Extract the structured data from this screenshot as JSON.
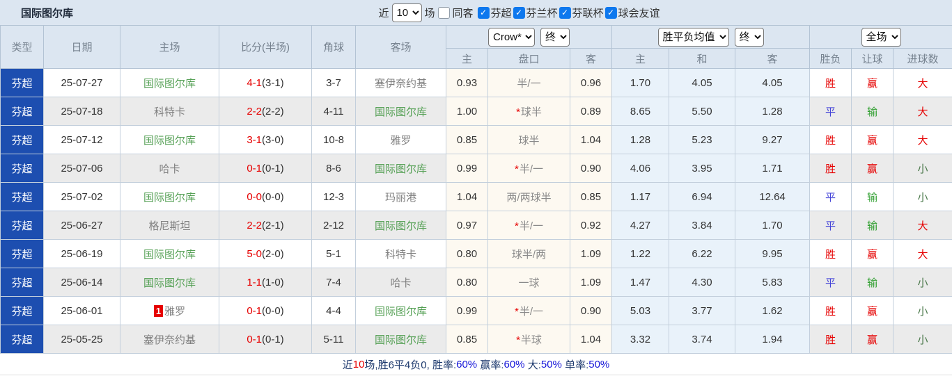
{
  "header": {
    "title": "国际图尔库",
    "recent_label": "近",
    "recent_value": "10",
    "matches_label": "场",
    "same_venue": {
      "label": "同客",
      "checked": false
    },
    "filters": [
      {
        "label": "芬超",
        "checked": true
      },
      {
        "label": "芬兰杯",
        "checked": true
      },
      {
        "label": "芬联杯",
        "checked": true
      },
      {
        "label": "球会友谊",
        "checked": true
      }
    ]
  },
  "table": {
    "headers": {
      "type": "类型",
      "date": "日期",
      "home": "主场",
      "score": "比分(半场)",
      "corner": "角球",
      "away": "客场",
      "odds_home": "主",
      "odds_line": "盘口",
      "odds_away": "客",
      "avg_home": "主",
      "avg_draw": "和",
      "avg_away": "客",
      "result": "胜负",
      "handicap": "让球",
      "goals": "进球数"
    },
    "selects": {
      "bookmaker": "Crow*",
      "bookmaker_stage": "终",
      "average": "胜平负均值",
      "average_stage": "终",
      "scope": "全场"
    },
    "rows": [
      {
        "league": "芬超",
        "date": "25-07-27",
        "home": {
          "name": "国际图尔库",
          "focus": true
        },
        "score": "4-1",
        "half": "(3-1)",
        "corner": "3-7",
        "away": {
          "name": "塞伊奈约基",
          "focus": false
        },
        "odds": [
          "0.93",
          "半/一",
          "0.96"
        ],
        "line_star": false,
        "avg": [
          "1.70",
          "4.05",
          "4.05"
        ],
        "result": {
          "text": "胜",
          "color": "red"
        },
        "handicap": {
          "text": "赢",
          "color": "red"
        },
        "goals": {
          "text": "大",
          "color": "red"
        }
      },
      {
        "league": "芬超",
        "date": "25-07-18",
        "home": {
          "name": "科特卡",
          "focus": false
        },
        "score": "2-2",
        "half": "(2-2)",
        "corner": "4-11",
        "away": {
          "name": "国际图尔库",
          "focus": true
        },
        "odds": [
          "1.00",
          "球半",
          "0.89"
        ],
        "line_star": true,
        "avg": [
          "8.65",
          "5.50",
          "1.28"
        ],
        "result": {
          "text": "平",
          "color": "blue"
        },
        "handicap": {
          "text": "输",
          "color": "green"
        },
        "goals": {
          "text": "大",
          "color": "red"
        }
      },
      {
        "league": "芬超",
        "date": "25-07-12",
        "home": {
          "name": "国际图尔库",
          "focus": true
        },
        "score": "3-1",
        "half": "(3-0)",
        "corner": "10-8",
        "away": {
          "name": "雅罗",
          "focus": false
        },
        "odds": [
          "0.85",
          "球半",
          "1.04"
        ],
        "line_star": false,
        "avg": [
          "1.28",
          "5.23",
          "9.27"
        ],
        "result": {
          "text": "胜",
          "color": "red"
        },
        "handicap": {
          "text": "赢",
          "color": "red"
        },
        "goals": {
          "text": "大",
          "color": "red"
        }
      },
      {
        "league": "芬超",
        "date": "25-07-06",
        "home": {
          "name": "哈卡",
          "focus": false
        },
        "score": "0-1",
        "half": "(0-1)",
        "corner": "8-6",
        "away": {
          "name": "国际图尔库",
          "focus": true
        },
        "odds": [
          "0.99",
          "半/一",
          "0.90"
        ],
        "line_star": true,
        "avg": [
          "4.06",
          "3.95",
          "1.71"
        ],
        "result": {
          "text": "胜",
          "color": "red"
        },
        "handicap": {
          "text": "赢",
          "color": "red"
        },
        "goals": {
          "text": "小",
          "color": "dgreen"
        }
      },
      {
        "league": "芬超",
        "date": "25-07-02",
        "home": {
          "name": "国际图尔库",
          "focus": true
        },
        "score": "0-0",
        "half": "(0-0)",
        "corner": "12-3",
        "away": {
          "name": "玛丽港",
          "focus": false
        },
        "odds": [
          "1.04",
          "两/两球半",
          "0.85"
        ],
        "line_star": false,
        "avg": [
          "1.17",
          "6.94",
          "12.64"
        ],
        "result": {
          "text": "平",
          "color": "blue"
        },
        "handicap": {
          "text": "输",
          "color": "green"
        },
        "goals": {
          "text": "小",
          "color": "dgreen"
        }
      },
      {
        "league": "芬超",
        "date": "25-06-27",
        "home": {
          "name": "格尼斯坦",
          "focus": false
        },
        "score": "2-2",
        "half": "(2-1)",
        "corner": "2-12",
        "away": {
          "name": "国际图尔库",
          "focus": true
        },
        "odds": [
          "0.97",
          "半/一",
          "0.92"
        ],
        "line_star": true,
        "avg": [
          "4.27",
          "3.84",
          "1.70"
        ],
        "result": {
          "text": "平",
          "color": "blue"
        },
        "handicap": {
          "text": "输",
          "color": "green"
        },
        "goals": {
          "text": "大",
          "color": "red"
        }
      },
      {
        "league": "芬超",
        "date": "25-06-19",
        "home": {
          "name": "国际图尔库",
          "focus": true
        },
        "score": "5-0",
        "half": "(2-0)",
        "corner": "5-1",
        "away": {
          "name": "科特卡",
          "focus": false
        },
        "odds": [
          "0.80",
          "球半/两",
          "1.09"
        ],
        "line_star": false,
        "avg": [
          "1.22",
          "6.22",
          "9.95"
        ],
        "result": {
          "text": "胜",
          "color": "red"
        },
        "handicap": {
          "text": "赢",
          "color": "red"
        },
        "goals": {
          "text": "大",
          "color": "red"
        }
      },
      {
        "league": "芬超",
        "date": "25-06-14",
        "home": {
          "name": "国际图尔库",
          "focus": true
        },
        "score": "1-1",
        "half": "(1-0)",
        "corner": "7-4",
        "away": {
          "name": "哈卡",
          "focus": false
        },
        "odds": [
          "0.80",
          "一球",
          "1.09"
        ],
        "line_star": false,
        "avg": [
          "1.47",
          "4.30",
          "5.83"
        ],
        "result": {
          "text": "平",
          "color": "blue"
        },
        "handicap": {
          "text": "输",
          "color": "green"
        },
        "goals": {
          "text": "小",
          "color": "dgreen"
        }
      },
      {
        "league": "芬超",
        "date": "25-06-01",
        "home": {
          "name": "雅罗",
          "focus": false,
          "red_card": "1"
        },
        "score": "0-1",
        "half": "(0-0)",
        "corner": "4-4",
        "away": {
          "name": "国际图尔库",
          "focus": true
        },
        "odds": [
          "0.99",
          "半/一",
          "0.90"
        ],
        "line_star": true,
        "avg": [
          "5.03",
          "3.77",
          "1.62"
        ],
        "result": {
          "text": "胜",
          "color": "red"
        },
        "handicap": {
          "text": "赢",
          "color": "red"
        },
        "goals": {
          "text": "小",
          "color": "dgreen"
        }
      },
      {
        "league": "芬超",
        "date": "25-05-25",
        "home": {
          "name": "塞伊奈约基",
          "focus": false
        },
        "score": "0-1",
        "half": "(0-1)",
        "corner": "5-11",
        "away": {
          "name": "国际图尔库",
          "focus": true
        },
        "odds": [
          "0.85",
          "半球",
          "1.04"
        ],
        "line_star": true,
        "avg": [
          "3.32",
          "3.74",
          "1.94"
        ],
        "result": {
          "text": "胜",
          "color": "red"
        },
        "handicap": {
          "text": "赢",
          "color": "red"
        },
        "goals": {
          "text": "小",
          "color": "dgreen"
        }
      }
    ]
  },
  "footer": {
    "segments": [
      {
        "text": "近",
        "color": "base"
      },
      {
        "text": "10",
        "color": "red"
      },
      {
        "text": "场,胜6平4负0, 胜率:",
        "color": "base"
      },
      {
        "text": "60%",
        "color": "blue"
      },
      {
        "text": " 赢率:",
        "color": "base"
      },
      {
        "text": "60%",
        "color": "blue"
      },
      {
        "text": " 大:",
        "color": "base"
      },
      {
        "text": "50%",
        "color": "blue"
      },
      {
        "text": " 单率:",
        "color": "base"
      },
      {
        "text": "50%",
        "color": "blue"
      }
    ]
  }
}
